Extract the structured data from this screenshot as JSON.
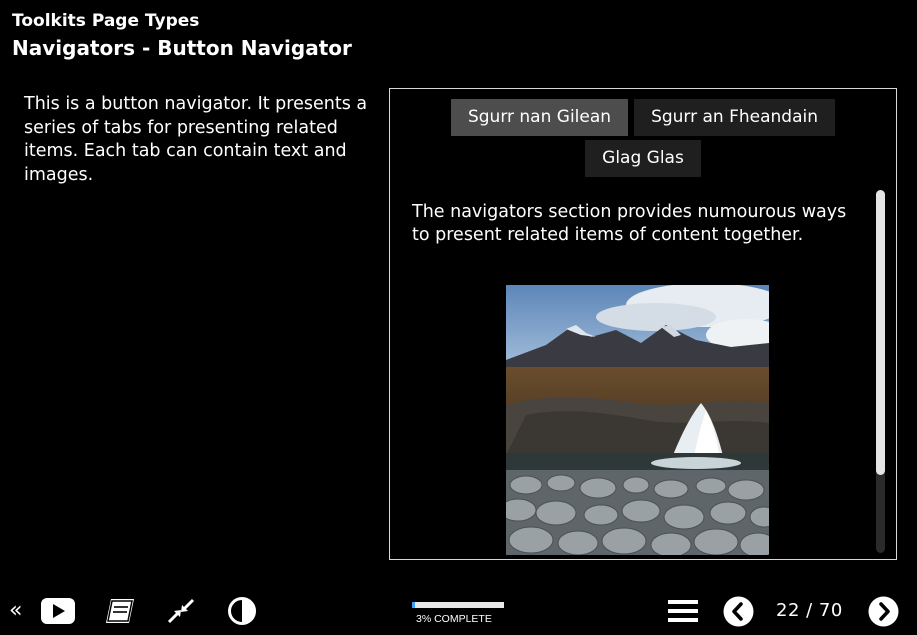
{
  "header": {
    "subtitle": "Toolkits Page Types",
    "title": "Navigators - Button Navigator"
  },
  "intro": {
    "text": "This is a button navigator. It presents a series of tabs for presenting related items. Each tab can contain text and images."
  },
  "navigator": {
    "tabs": [
      {
        "label": "Sgurr nan Gilean",
        "active": true
      },
      {
        "label": "Sgurr an Fheandain",
        "active": false
      },
      {
        "label": "Glag Glas",
        "active": false
      }
    ],
    "content_text": "The navigators section provides numourous ways to present related items of content together.",
    "image": "mountain-waterfall-photo"
  },
  "footer": {
    "back_glyph": "«",
    "icons": [
      "double-chevron-left-icon",
      "play-video-icon",
      "glossary-book-icon",
      "collapse-icon",
      "contrast-icon",
      "menu-icon",
      "previous-icon",
      "next-icon"
    ],
    "progress": {
      "percent": 3,
      "label": "3% COMPLETE"
    },
    "page_counter": "22 / 70"
  },
  "colors": {
    "background": "#000000",
    "tab": "#1f1f1f",
    "tab_active": "#4d4d4d",
    "progress_fill": "#3aa0ff"
  }
}
